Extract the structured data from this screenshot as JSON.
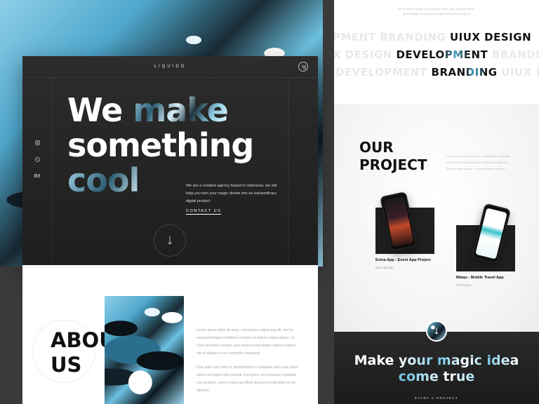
{
  "hero": {
    "logo": "LIQUIDO",
    "headline_line1_a": "We ",
    "headline_line1_b": "make",
    "headline_line2": "something",
    "headline_line3": "cool",
    "description": "We are a creative agency based in Indonesia. we will help you turn your magic dream into an extraordinary digital product",
    "contact_label": "CONTACT US",
    "social": [
      "instagram",
      "dribbble",
      "Bē"
    ]
  },
  "about": {
    "title_line1": "ABOUT",
    "title_line2": "US",
    "paragraph1": "Lorem ipsum dolor sit amet, consectetur adipiscing elit, sed do eiusmod tempor incididunt ut labore et dolore magna aliqua. Ut enim ad minim veniam, quis nostrud exercitation ullamco laboris nisi ut aliquip ex ea commodo consequat.",
    "paragraph2": "Duis aute irure dolor in reprehenderit in voluptate velit esse cillum dolore eu fugiat nulla pariatur. Excepteur sint occaecat cupidatat non proident, sunt in culpa qui officia deserunt mollit anim id est laborum."
  },
  "services": {
    "intro_line1": "We provide a variety of services to make your company better,",
    "intro_line2": "don't hesitate to show your extraordinary ideas with us",
    "row1": {
      "ghost": "PMENT  BRANDING  ",
      "bold": "UIUX DESIGN"
    },
    "row2": {
      "ghost_left": "X DESIGN  ",
      "bold": "DEVELOPMENT",
      "ghost_right": "  BRANDING"
    },
    "row3": {
      "ghost": "DEVELOPMENT  ",
      "bold": "BRANDING",
      "ghost_right": "  UIUX DES"
    }
  },
  "projects": {
    "title_line1": "OUR",
    "title_line2": "PROJECT",
    "description": "Lorem ipsum dolor sit amet, consectetur adipiscing elit, sed do eiusmod tempor incididunt ut labore et dolore magna aliqua. Ut enim ad minim veniam.",
    "items": [
      {
        "name": "Evina App - Event App Project",
        "category": "UIUX Design"
      },
      {
        "name": "Miaqu - Mobile Travel App",
        "category": "UX Project"
      }
    ]
  },
  "cta": {
    "line1_a": "Make ",
    "line1_b": "your magic idea",
    "line2": "come true",
    "link": "START A PROJECT"
  },
  "colors": {
    "accent": "#4fa7cc",
    "dark": "#1e1e1e",
    "light": "#ffffff"
  }
}
